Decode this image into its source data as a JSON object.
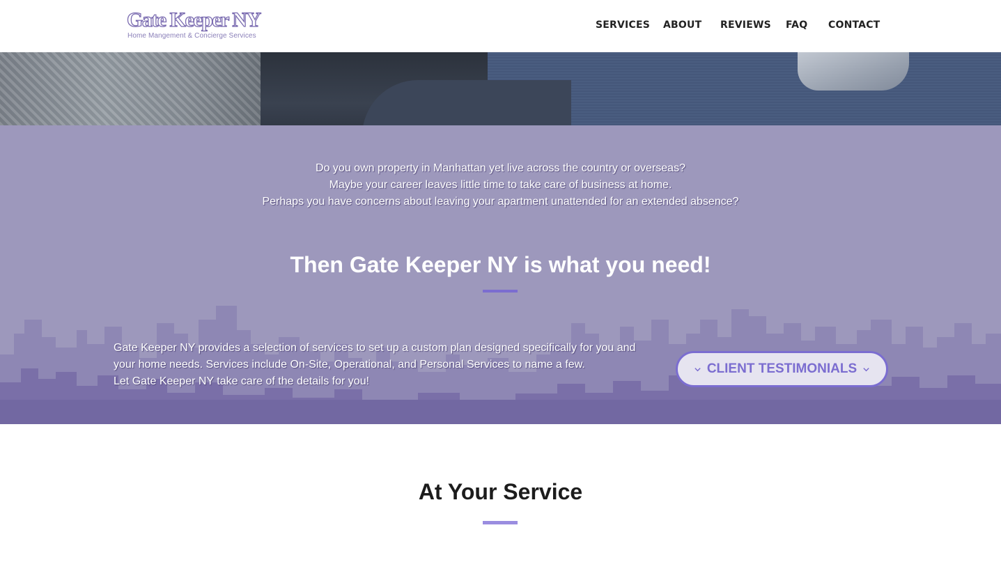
{
  "header": {
    "logo_title": "Gate Keeper NY",
    "logo_subtitle": "Home Mangement & Concierge Services",
    "nav": [
      "SERVICES",
      "ABOUT",
      "REVIEWS",
      "FAQ",
      "CONTACT"
    ]
  },
  "intro": {
    "lead_lines": [
      "Do you own property in Manhattan yet live across the country or overseas?",
      "Maybe your career leaves little time to take care of business at home.",
      "Perhaps you have concerns about leaving your apartment unattended for an extended absence?"
    ],
    "headline": "Then Gate Keeper NY is what you need!",
    "description_lines": [
      "Gate Keeper NY provides a selection of services to set up a custom plan designed specifically for you and",
      "your home needs. Services include On-Site, Operational, and Personal Services to name a few.",
      "Let Gate Keeper NY take care of the details for you!"
    ],
    "testimonials_button": "CLIENT TESTIMONIALS"
  },
  "service": {
    "title": "At Your Service"
  },
  "colors": {
    "accent": "#7b6dd0",
    "intro_background": "#9d98bc",
    "skyline": "#7a6fa8",
    "button_background": "#e6e4f0"
  },
  "icons": {
    "button_left": "chevron-down-icon",
    "button_right": "chevron-down-icon"
  }
}
